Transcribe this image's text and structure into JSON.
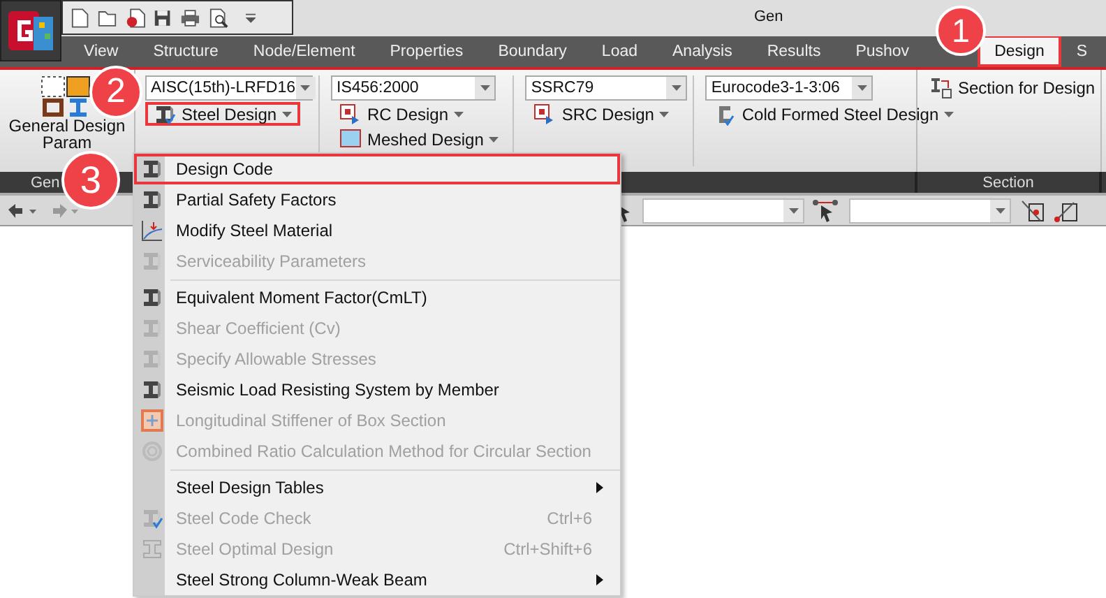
{
  "app_title": "Gen",
  "tabs": [
    {
      "label": "View",
      "selected": false,
      "annotated": false
    },
    {
      "label": "Structure",
      "selected": false,
      "annotated": false
    },
    {
      "label": "Node/Element",
      "selected": false,
      "annotated": false
    },
    {
      "label": "Properties",
      "selected": false,
      "annotated": false
    },
    {
      "label": "Boundary",
      "selected": false,
      "annotated": false
    },
    {
      "label": "Load",
      "selected": false,
      "annotated": false
    },
    {
      "label": "Analysis",
      "selected": false,
      "annotated": false
    },
    {
      "label": "Results",
      "selected": false,
      "annotated": false
    },
    {
      "label": "Pushov",
      "selected": false,
      "annotated": false
    },
    {
      "label": "Design",
      "selected": true,
      "annotated": true
    },
    {
      "label": "S",
      "selected": false,
      "annotated": false
    }
  ],
  "general_group": {
    "button_lines": [
      "General Design",
      "Param"
    ],
    "group_label": "Gen"
  },
  "design_group": {
    "columns": [
      {
        "code": "AISC(15th)-LRFD16",
        "buttons": [
          {
            "label": "Steel Design",
            "annotated": true
          }
        ]
      },
      {
        "code": "IS456:2000",
        "buttons": [
          {
            "label": "RC Design",
            "annotated": false
          },
          {
            "label": "Meshed Design",
            "annotated": false
          }
        ]
      },
      {
        "code": "SSRC79",
        "buttons": [
          {
            "label": "SRC Design",
            "annotated": false
          }
        ]
      },
      {
        "code": "Eurocode3-1-3:06",
        "buttons": [
          {
            "label": "Cold Formed Steel Design",
            "annotated": false
          }
        ]
      }
    ]
  },
  "section_group": {
    "button": "Section for Design",
    "group_label": "Section"
  },
  "menu": {
    "items": [
      {
        "kind": "item",
        "label": "Design Code",
        "disabled": false,
        "annotated": true
      },
      {
        "kind": "item",
        "label": "Partial Safety Factors",
        "disabled": false,
        "annotated": false
      },
      {
        "kind": "item",
        "label": "Modify Steel Material",
        "disabled": false,
        "annotated": false
      },
      {
        "kind": "item",
        "label": "Serviceability Parameters",
        "disabled": true,
        "annotated": false
      },
      {
        "kind": "separator"
      },
      {
        "kind": "item",
        "label": "Equivalent Moment Factor(CmLT)",
        "disabled": false,
        "annotated": false
      },
      {
        "kind": "item",
        "label": "Shear Coefficient (Cv)",
        "disabled": true,
        "annotated": false
      },
      {
        "kind": "item",
        "label": "Specify Allowable Stresses",
        "disabled": true,
        "annotated": false
      },
      {
        "kind": "item",
        "label": "Seismic Load Resisting System by Member",
        "disabled": false,
        "annotated": false
      },
      {
        "kind": "item",
        "label": "Longitudinal Stiffener of Box Section",
        "disabled": true,
        "annotated": false
      },
      {
        "kind": "item",
        "label": "Combined Ratio Calculation Method for Circular Section",
        "disabled": true,
        "annotated": false
      },
      {
        "kind": "separator"
      },
      {
        "kind": "submenu",
        "label": "Steel Design Tables",
        "disabled": false,
        "annotated": false
      },
      {
        "kind": "item",
        "label": "Steel Code Check",
        "shortcut": "Ctrl+6",
        "disabled": true,
        "annotated": false
      },
      {
        "kind": "item",
        "label": "Steel Optimal Design",
        "shortcut": "Ctrl+Shift+6",
        "disabled": true,
        "annotated": false
      },
      {
        "kind": "submenu",
        "label": "Steel Strong Column-Weak Beam",
        "disabled": false,
        "annotated": false
      }
    ]
  },
  "callouts": [
    "1",
    "2",
    "3"
  ]
}
